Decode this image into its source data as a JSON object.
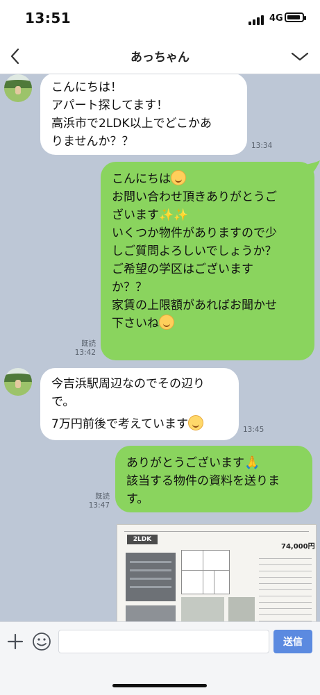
{
  "status_bar": {
    "time": "13:51",
    "network": "4G"
  },
  "header": {
    "title": "あっちゃん",
    "back_icon": "chevron-left-icon",
    "menu_icon": "chevron-down-icon"
  },
  "messages": [
    {
      "side": "left",
      "lines": [
        "こんにちは！",
        "アパート探してます！",
        "高浜市で2LDK以上でどこかあ",
        "りませんか？？"
      ],
      "time": "13:34"
    },
    {
      "side": "right",
      "lines": [
        "こんにちは",
        "お問い合わせ頂きありがとうご",
        "ざいます",
        "いくつか物件がありますので少",
        "しご質問よろしいでしょうか？",
        "ご希望の学区はございます",
        "か？？",
        "家賃の上限額があればお聞かせ",
        "下さいね"
      ],
      "read": "既読",
      "time": "13:42"
    },
    {
      "side": "left",
      "lines": [
        "今吉浜駅周辺なのでその辺り",
        "で。",
        "7万円前後で考えています"
      ],
      "time": "13:45"
    },
    {
      "side": "right",
      "lines": [
        "ありがとうございます",
        "該当する物件の資料を送りま",
        "す。"
      ],
      "read": "既読",
      "time": "13:47"
    }
  ],
  "attachment": {
    "tag": "2LDK",
    "price": "74,000円"
  },
  "input": {
    "placeholder": "",
    "send_label": "送信"
  },
  "colors": {
    "chat_bg": "#bdc7d6",
    "outgoing": "#8ad45e",
    "incoming": "#ffffff",
    "send": "#5b8ae0"
  }
}
